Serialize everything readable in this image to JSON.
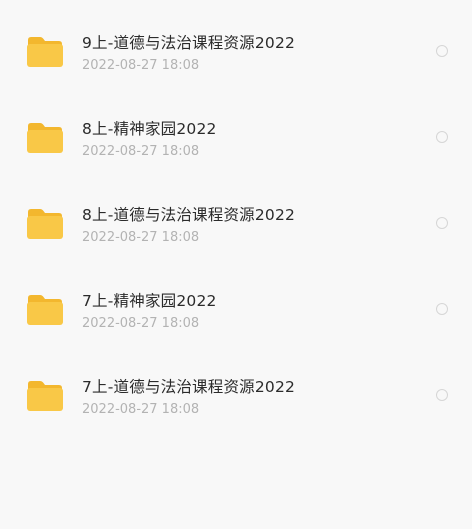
{
  "files": [
    {
      "name": "9上-道德与法治课程资源2022",
      "date": "2022-08-27 18:08",
      "icon": "folder-icon"
    },
    {
      "name": "8上-精神家园2022",
      "date": "2022-08-27 18:08",
      "icon": "folder-icon"
    },
    {
      "name": "8上-道德与法治课程资源2022",
      "date": "2022-08-27 18:08",
      "icon": "folder-icon"
    },
    {
      "name": "7上-精神家园2022",
      "date": "2022-08-27 18:08",
      "icon": "folder-icon"
    },
    {
      "name": "7上-道德与法治课程资源2022",
      "date": "2022-08-27 18:08",
      "icon": "folder-icon"
    }
  ],
  "colors": {
    "background": "#f8f8f8",
    "folder": "#f9c847",
    "folder_tab": "#f3b72e",
    "name_text": "#2b2b2b",
    "date_text": "#b3b3b3",
    "radio_border": "#d6d6d6"
  }
}
